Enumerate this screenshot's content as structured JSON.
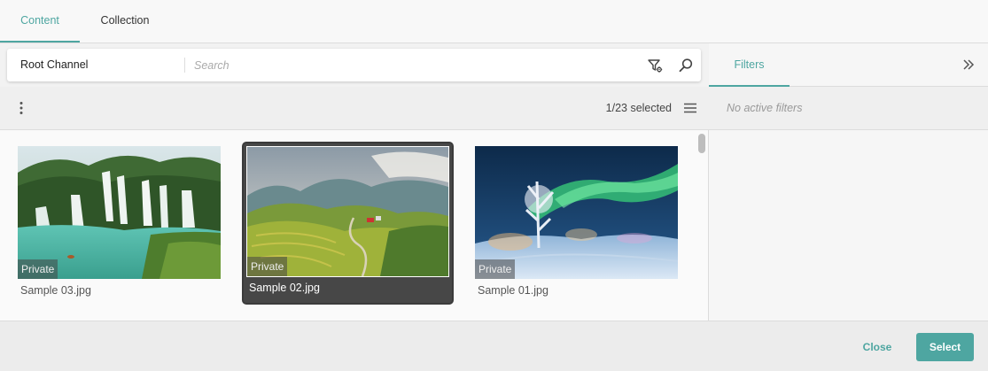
{
  "tabs": [
    {
      "label": "Content",
      "active": true
    },
    {
      "label": "Collection",
      "active": false
    }
  ],
  "search": {
    "channel": "Root Channel",
    "placeholder": "Search"
  },
  "toolbar": {
    "selected_count": "1/23 selected"
  },
  "items": [
    {
      "name": "Sample 03.jpg",
      "badge": "Private",
      "selected": false,
      "image": "waterfall"
    },
    {
      "name": "Sample 02.jpg",
      "badge": "Private",
      "selected": true,
      "image": "terraced-hills"
    },
    {
      "name": "Sample 01.jpg",
      "badge": "Private",
      "selected": false,
      "image": "aurora-snow"
    }
  ],
  "filters": {
    "tab_label": "Filters",
    "empty_text": "No active filters"
  },
  "footer": {
    "close_label": "Close",
    "select_label": "Select"
  },
  "colors": {
    "accent": "#4ea6a1",
    "selected_card": "#474747"
  },
  "icons": [
    "filter-settings-icon",
    "search-icon",
    "more-vertical-icon",
    "list-view-icon",
    "double-chevron-right-icon"
  ]
}
